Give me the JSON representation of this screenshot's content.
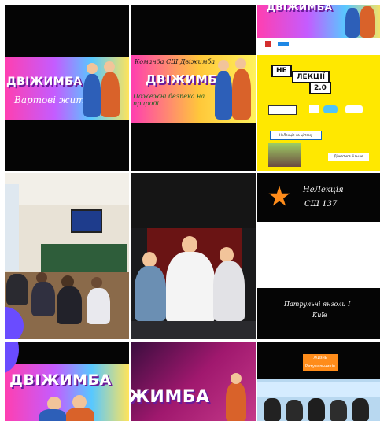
{
  "tiles": [
    {
      "name": "Двіжимба Вартові життя",
      "title": "ДВІЖИМБА",
      "subtitle": "Вартові життя"
    },
    {
      "name": "Двіжимба Команда",
      "caption_top": "Команда СШ Двіжимба",
      "title": "ДВІЖИМБА",
      "caption_bottom": "Пожежні безпека на природі"
    },
    {
      "name": "Не лекції 2.0",
      "top_title": "ДВІЖИМБА",
      "title_ne": "НЕ",
      "title_lektsii": "ЛЕКЦІЇ",
      "version": "2.0",
      "strip_label": "НеЛекція на ці тему",
      "footer_label": "Дізнатися більше"
    },
    {
      "name": "Classroom"
    },
    {
      "name": "Boys"
    },
    {
      "name": "НеЛекція СШ 137",
      "line1": "НеЛекція",
      "line2": "СШ 137",
      "bottom1": "Патрульні янголи І",
      "bottom2": "Київ"
    },
    {
      "name": "Двіжимба bottom 1",
      "title": "ДВІЖИМБА"
    },
    {
      "name": "Двіжимба bottom 2",
      "title": "ЖИМБА"
    },
    {
      "name": "Rescuers",
      "sign": "Жизнь Рятувальників"
    }
  ],
  "colors": {
    "black": "#050505",
    "yellow": "#ffe800",
    "pink": "#ff3fb0",
    "blue": "#58c8ff",
    "purple": "#6a1b9a"
  }
}
